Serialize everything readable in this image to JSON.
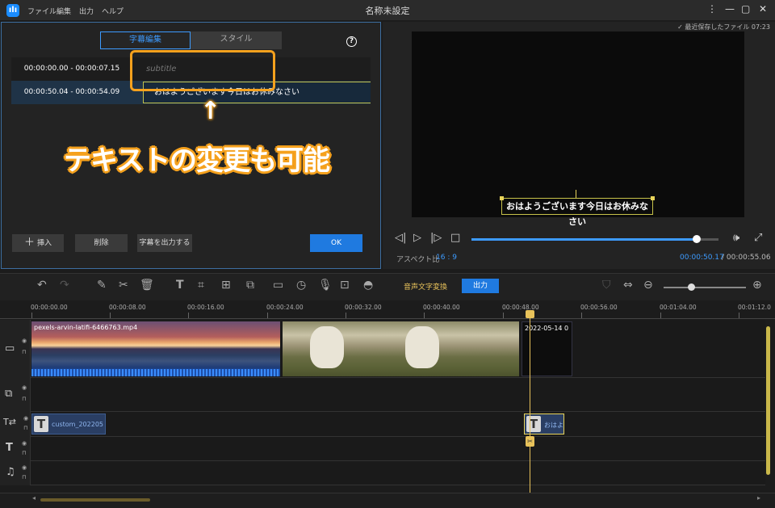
{
  "app": {
    "title": "名称未設定",
    "menu": [
      "ファイル",
      "編集",
      "出力",
      "ヘルプ"
    ],
    "last_saved": "最近保存したファイル 07:23"
  },
  "editor": {
    "tabs": [
      "字幕編集",
      "スタイル"
    ],
    "rows": [
      {
        "time": "00:00:00.00 - 00:00:07.15",
        "text": "subtitle"
      },
      {
        "time": "00:00:50.04 - 00:00:54.09",
        "text": "おはようございます今日はお休みなさい"
      }
    ],
    "insert_label": "挿入",
    "delete_label": "削除",
    "export_label": "字幕を出力する",
    "ok_label": "OK"
  },
  "annotation": {
    "arrow": "↑",
    "text": "テキストの変更も可能"
  },
  "preview": {
    "subtitle": "おはようございます今日はお休みなさい",
    "aspect_label": "アスペクト比",
    "aspect_value": "16 : 9",
    "current_time": "00:00:50.17",
    "total_time": "/ 00:00:55.06",
    "progress": 0.91
  },
  "toolbar": {
    "speech_to_text": "音声文字変換",
    "export": "出力"
  },
  "timeline": {
    "ticks": [
      "00:00:00.00",
      "00:00:08.00",
      "00:00:16.00",
      "00:00:24.00",
      "00:00:32.00",
      "00:00:40.00",
      "00:00:48.00",
      "00:00:56.00",
      "00:01:04.00",
      "00:01:12.0"
    ],
    "clip1_name": "pexels-arvin-latifi-6466763.mp4",
    "clip3_name": "2022-05-14 0",
    "subtitle_clip1": "custom_202205",
    "subtitle_clip2": "おはよ"
  },
  "colors": {
    "accent": "#1f7ae0",
    "highlight": "#f5a11d",
    "playhead": "#e8c25a"
  }
}
